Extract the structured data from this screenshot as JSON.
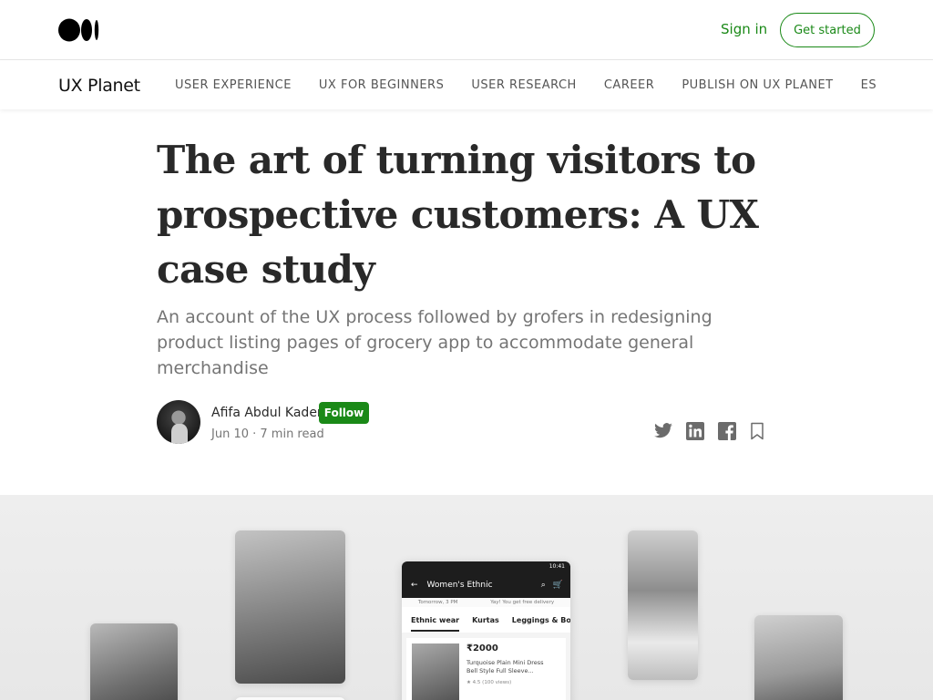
{
  "header": {
    "signin_label": "Sign in",
    "get_started_label": "Get started"
  },
  "publication": {
    "name": "UX Planet",
    "nav": [
      "USER EXPERIENCE",
      "UX FOR BEGINNERS",
      "USER RESEARCH",
      "CAREER",
      "PUBLISH ON UX PLANET",
      "ES"
    ]
  },
  "article": {
    "title": "The art of turning visitors to prospective customers: A UX case study",
    "subtitle": "An account of the UX process followed by grofers in redesigning product listing pages of grocery app to accommodate general merchandise",
    "author": "Afifa Abdul Kader",
    "follow_label": "Follow",
    "meta": "Jun 10 · 7 min read"
  },
  "share_icons": [
    "twitter-icon",
    "linkedin-icon",
    "facebook-icon",
    "bookmark-icon"
  ],
  "hero": {
    "phone": {
      "status_time": "10:41",
      "title": "Women's Ethnic",
      "delivery_1": "Tomorrow, 3 PM",
      "delivery_2": "Yay! You get free delivery",
      "tabs": [
        "Ethnic wear",
        "Kurtas",
        "Leggings & Bott"
      ],
      "product_price": "₹2000",
      "product_name": "Turquoise Plain Mini Dress Bell Style Full Sleeve...",
      "product_rating": "★ 4.5  (100 views)"
    }
  },
  "colors": {
    "brand_green": "#1a8917",
    "text": "#292929",
    "muted": "#757575"
  }
}
